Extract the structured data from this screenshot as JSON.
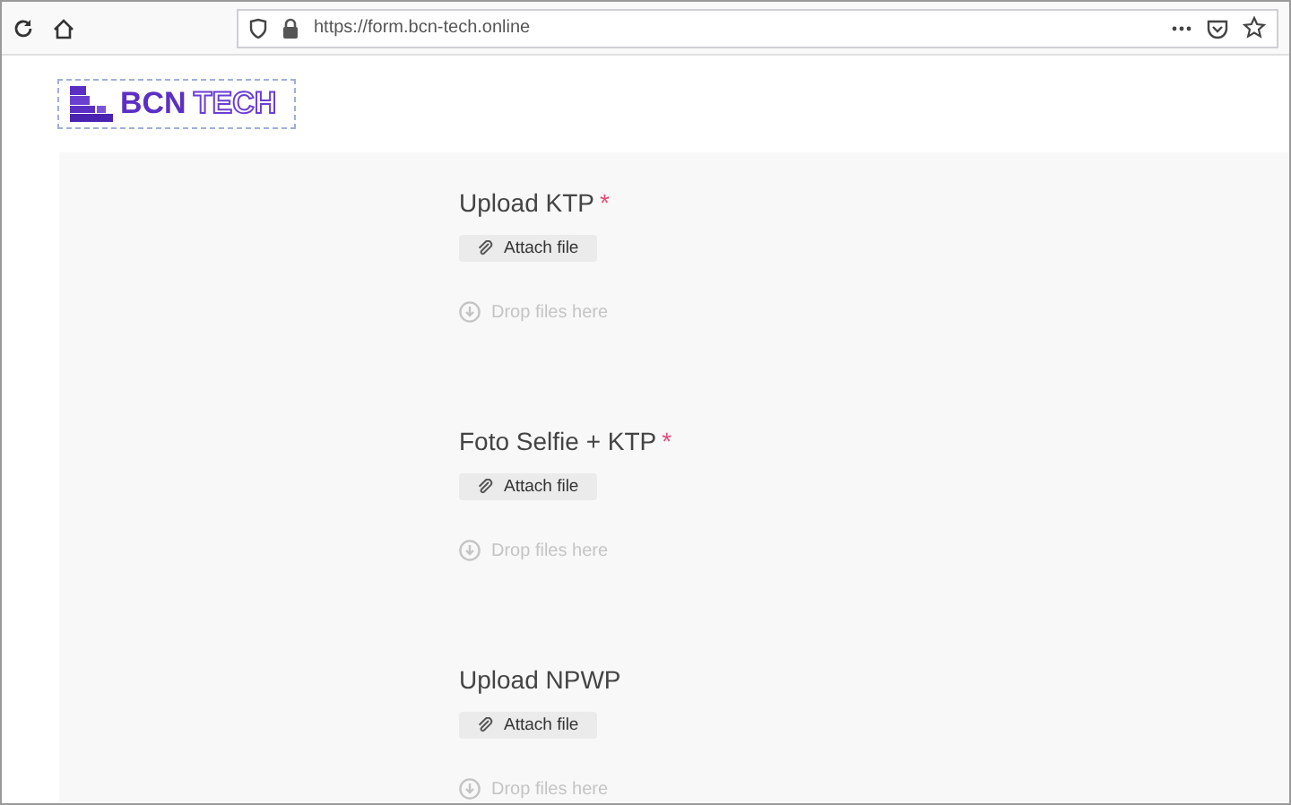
{
  "browser": {
    "url": "https://form.bcn-tech.online"
  },
  "logo": {
    "bold": "BCN",
    "outline": "TECH"
  },
  "fields": [
    {
      "label": "Upload KTP",
      "required_mark": "*",
      "button": "Attach file",
      "drop_hint": "Drop files here"
    },
    {
      "label": "Foto Selfie + KTP",
      "required_mark": "*",
      "button": "Attach file",
      "drop_hint": "Drop files here"
    },
    {
      "label": "Upload NPWP",
      "button": "Attach file",
      "drop_hint": "Drop files here"
    }
  ]
}
